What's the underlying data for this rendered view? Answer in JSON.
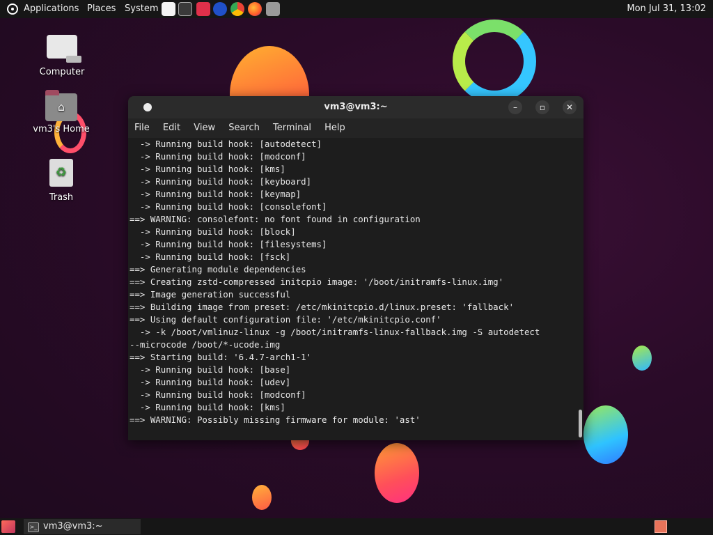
{
  "top_panel": {
    "menus": [
      "Applications",
      "Places",
      "System"
    ],
    "clock": "Mon Jul 31, 13:02"
  },
  "desktop": {
    "icons": [
      {
        "label": "Computer"
      },
      {
        "label": "vm3's Home"
      },
      {
        "label": "Trash"
      }
    ]
  },
  "window": {
    "title": "vm3@vm3:~",
    "menu": [
      "File",
      "Edit",
      "View",
      "Search",
      "Terminal",
      "Help"
    ]
  },
  "terminal_lines": [
    "  -> Running build hook: [autodetect]",
    "  -> Running build hook: [modconf]",
    "  -> Running build hook: [kms]",
    "  -> Running build hook: [keyboard]",
    "  -> Running build hook: [keymap]",
    "  -> Running build hook: [consolefont]",
    "==> WARNING: consolefont: no font found in configuration",
    "  -> Running build hook: [block]",
    "  -> Running build hook: [filesystems]",
    "  -> Running build hook: [fsck]",
    "==> Generating module dependencies",
    "==> Creating zstd-compressed initcpio image: '/boot/initramfs-linux.img'",
    "==> Image generation successful",
    "==> Building image from preset: /etc/mkinitcpio.d/linux.preset: 'fallback'",
    "==> Using default configuration file: '/etc/mkinitcpio.conf'",
    "  -> -k /boot/vmlinuz-linux -g /boot/initramfs-linux-fallback.img -S autodetect",
    "--microcode /boot/*-ucode.img",
    "==> Starting build: '6.4.7-arch1-1'",
    "  -> Running build hook: [base]",
    "  -> Running build hook: [udev]",
    "  -> Running build hook: [modconf]",
    "  -> Running build hook: [kms]",
    "==> WARNING: Possibly missing firmware for module: 'ast'"
  ],
  "bottom_panel": {
    "task_label": "vm3@vm3:~"
  }
}
